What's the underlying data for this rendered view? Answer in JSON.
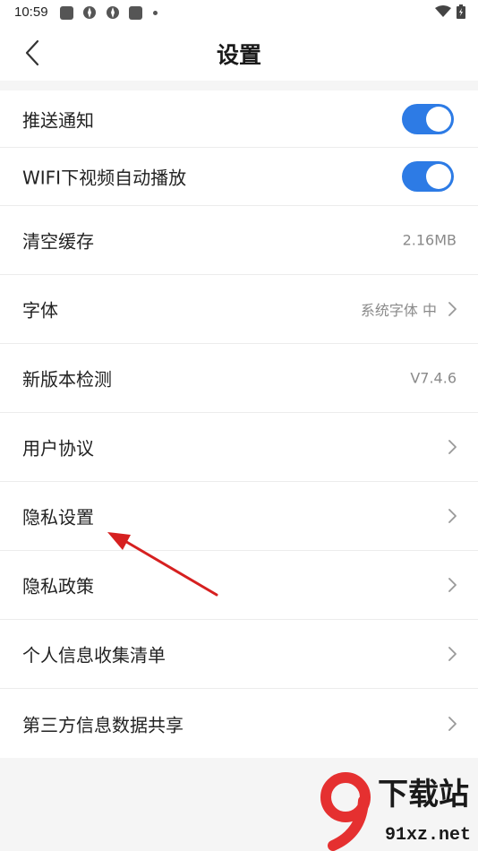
{
  "status_bar": {
    "time": "10:59"
  },
  "header": {
    "title": "设置"
  },
  "settings": [
    {
      "label": "推送通知",
      "type": "toggle",
      "on": true
    },
    {
      "label": "WIFI下视频自动播放",
      "type": "toggle",
      "on": true
    },
    {
      "label": "清空缓存",
      "type": "value",
      "value": "2.16MB"
    },
    {
      "label": "字体",
      "type": "value-chevron",
      "value": "系统字体 中"
    },
    {
      "label": "新版本检测",
      "type": "value",
      "value": "V7.4.6"
    },
    {
      "label": "用户协议",
      "type": "chevron"
    },
    {
      "label": "隐私设置",
      "type": "chevron"
    },
    {
      "label": "隐私政策",
      "type": "chevron"
    },
    {
      "label": "个人信息收集清单",
      "type": "chevron"
    },
    {
      "label": "第三方信息数据共享",
      "type": "chevron"
    }
  ],
  "watermark": {
    "brand": "下载站",
    "domain": "91xz.net"
  },
  "colors": {
    "accent": "#2d7be5",
    "annotation_arrow": "#d62020"
  }
}
